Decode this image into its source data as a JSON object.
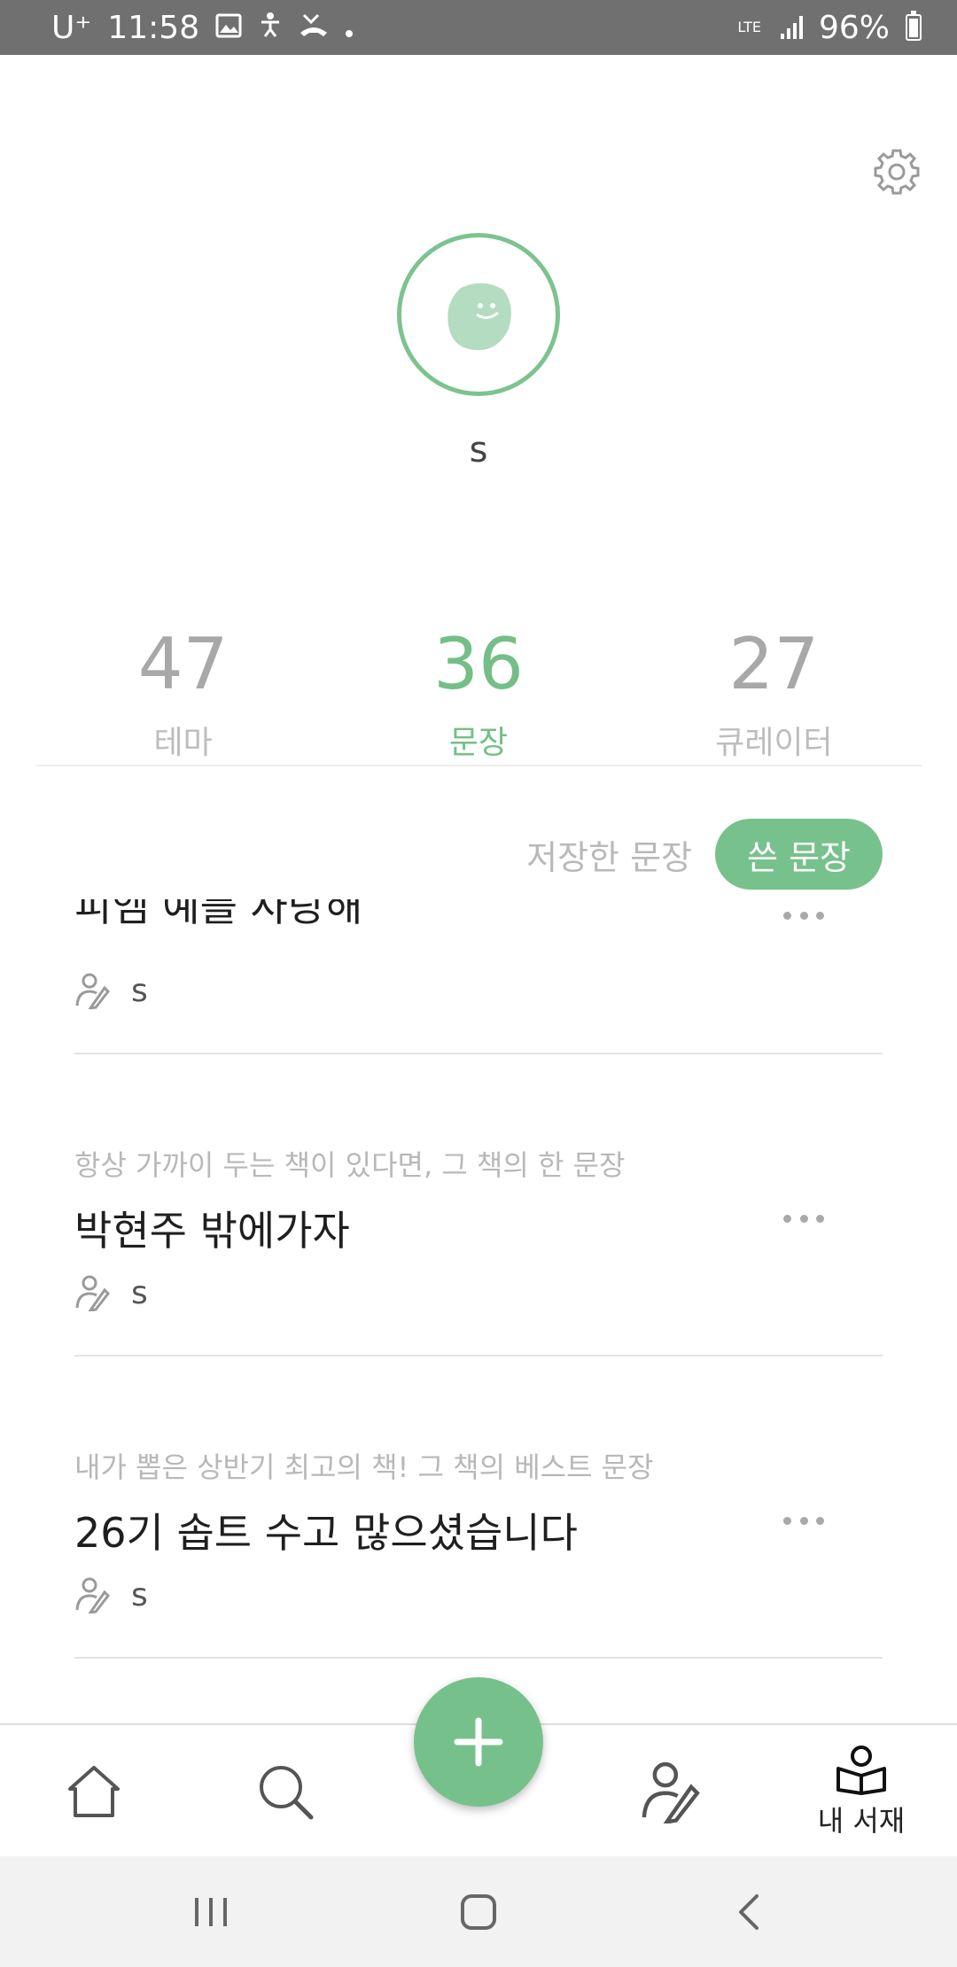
{
  "status_bar": {
    "carrier": "U⁺",
    "time": "11:58",
    "icons": [
      "gallery-icon",
      "accessibility-icon",
      "missed-call-icon",
      "dot-icon"
    ],
    "network": "LTE",
    "battery": "96%"
  },
  "profile": {
    "username": "s"
  },
  "stats": [
    {
      "value": "47",
      "label": "테마"
    },
    {
      "value": "36",
      "label": "문장"
    },
    {
      "value": "27",
      "label": "큐레이터"
    }
  ],
  "toggle": {
    "saved": "저장한 문장",
    "written": "쓴 문장"
  },
  "items": [
    {
      "subtitle": "",
      "title": "피엠 예를 사랑해",
      "author": "s"
    },
    {
      "subtitle": "항상 가까이 두는 책이 있다면, 그 책의 한 문장",
      "title": "박현주 밖에가자",
      "author": "s"
    },
    {
      "subtitle": "내가 뽑은 상반기 최고의 책! 그 책의 베스트 문장",
      "title": "26기 솝트 수고 많으셨습니다",
      "author": "s"
    }
  ],
  "bottom_nav": {
    "library_label": "내 서재"
  },
  "colors": {
    "accent": "#76c18b",
    "status_bar": "#707070"
  }
}
